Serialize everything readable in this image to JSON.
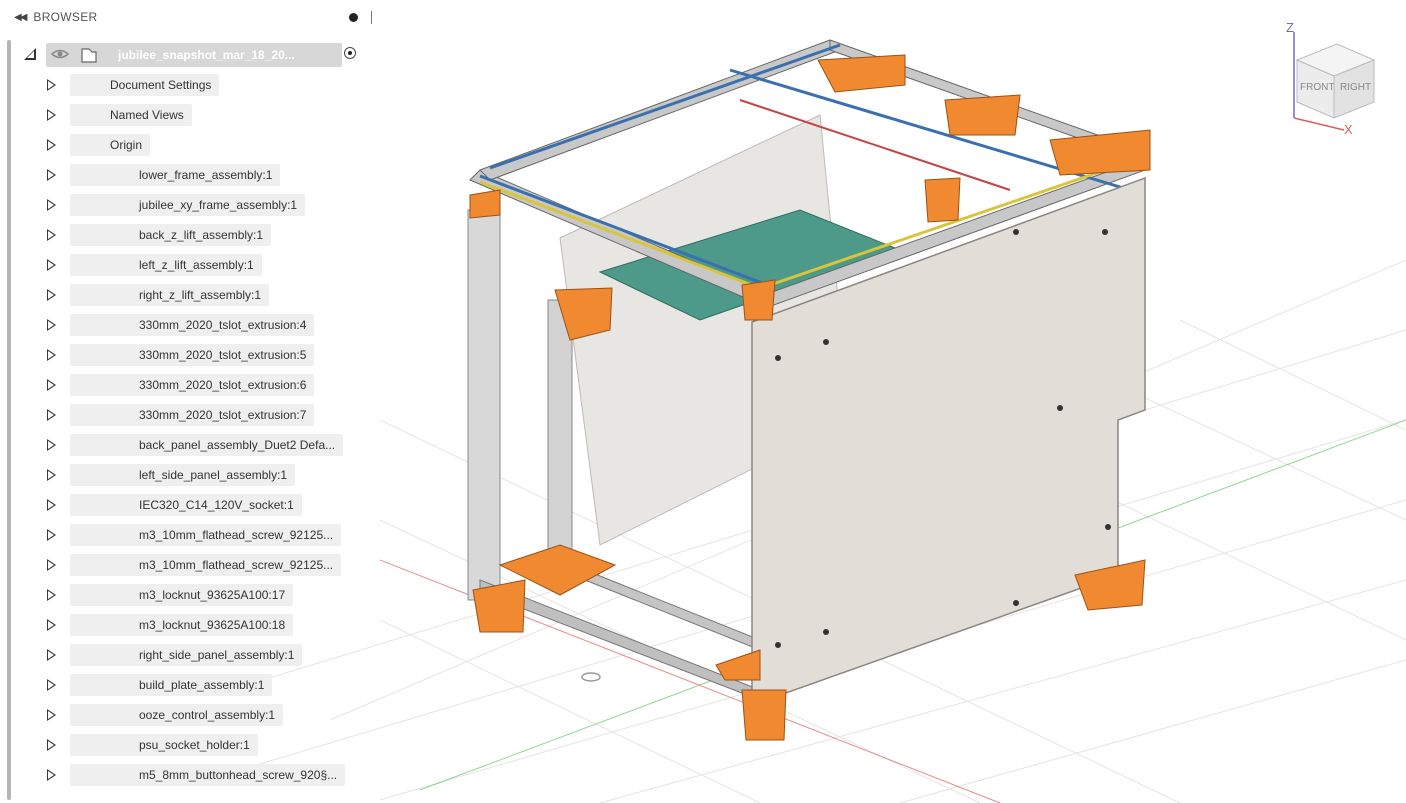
{
  "browser": {
    "title": "BROWSER",
    "root": {
      "label": "jubilee_snapshot_mar_18_20..."
    },
    "items": [
      {
        "label": "Document Settings",
        "icon": "gear-icon",
        "eye": "none"
      },
      {
        "label": "Named Views",
        "icon": "folder-icon",
        "eye": "none"
      },
      {
        "label": "Origin",
        "icon": "folder-icon",
        "eye": "hidden"
      },
      {
        "label": "lower_frame_assembly:1",
        "icon": "component-icon",
        "eye": "visible"
      },
      {
        "label": "jubilee_xy_frame_assembly:1",
        "icon": "component-icon",
        "eye": "visible"
      },
      {
        "label": "back_z_lift_assembly:1",
        "icon": "component-icon",
        "eye": "visible"
      },
      {
        "label": "left_z_lift_assembly:1",
        "icon": "component-icon",
        "eye": "visible"
      },
      {
        "label": "right_z_lift_assembly:1",
        "icon": "component-icon",
        "eye": "visible"
      },
      {
        "label": "330mm_2020_tslot_extrusion:4",
        "icon": "body-icon",
        "eye": "visible"
      },
      {
        "label": "330mm_2020_tslot_extrusion:5",
        "icon": "body-icon",
        "eye": "visible"
      },
      {
        "label": "330mm_2020_tslot_extrusion:6",
        "icon": "body-icon",
        "eye": "visible"
      },
      {
        "label": "330mm_2020_tslot_extrusion:7",
        "icon": "body-icon",
        "eye": "visible"
      },
      {
        "label": "back_panel_assembly_Duet2 Defa...",
        "icon": "component-icon",
        "eye": "visible"
      },
      {
        "label": "left_side_panel_assembly:1",
        "icon": "component-icon",
        "eye": "visible"
      },
      {
        "label": "IEC320_C14_120V_socket:1",
        "icon": "component-icon",
        "eye": "visible"
      },
      {
        "label": "m3_10mm_flathead_screw_92125...",
        "icon": "body-icon",
        "eye": "visible"
      },
      {
        "label": "m3_10mm_flathead_screw_92125...",
        "icon": "body-icon",
        "eye": "visible"
      },
      {
        "label": "m3_locknut_93625A100:17",
        "icon": "body-icon",
        "eye": "visible"
      },
      {
        "label": "m3_locknut_93625A100:18",
        "icon": "body-icon",
        "eye": "visible"
      },
      {
        "label": "right_side_panel_assembly:1",
        "icon": "component-icon",
        "eye": "visible"
      },
      {
        "label": "build_plate_assembly:1",
        "icon": "component-icon",
        "eye": "visible"
      },
      {
        "label": "ooze_control_assembly:1",
        "icon": "component-icon",
        "eye": "visible"
      },
      {
        "label": "psu_socket_holder:1",
        "icon": "body-icon",
        "eye": "visible"
      },
      {
        "label": "m5_8mm_buttonhead_screw_920§...",
        "icon": "body-icon",
        "eye": "visible"
      }
    ]
  },
  "viewcube": {
    "axis_z": "Z",
    "axis_x": "X",
    "face_front": "FRONT",
    "face_right": "RIGHT"
  },
  "colors": {
    "accent_orange": "#f0892f",
    "panel_gray": "#e2ddd7",
    "bed_teal": "#4e9a8a",
    "axis_red": "#e05a5a",
    "axis_green": "#6ac46a",
    "grid_line": "#dcdcdc"
  }
}
